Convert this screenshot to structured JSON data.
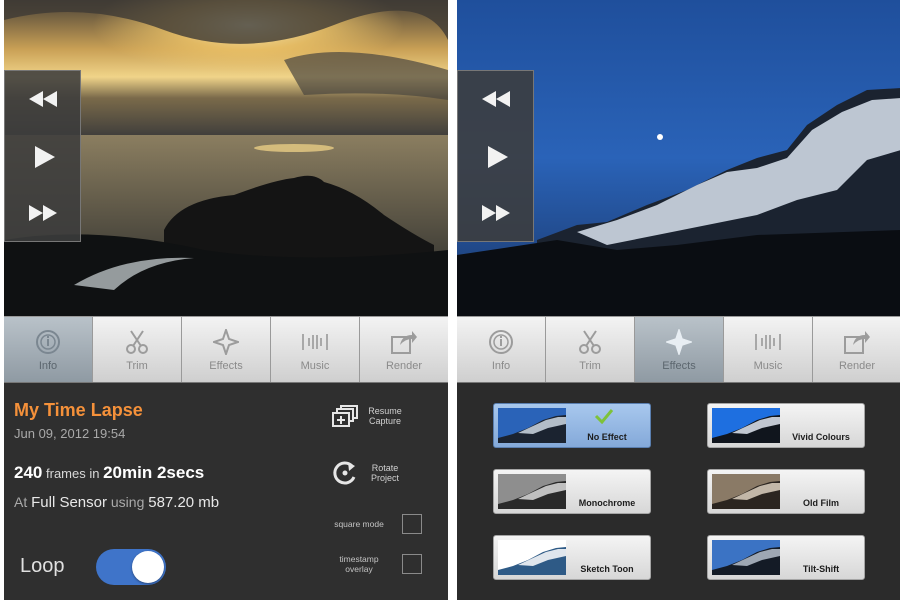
{
  "left_screen": {
    "tabs": [
      {
        "label": "Info",
        "icon": "info-icon",
        "active": true
      },
      {
        "label": "Trim",
        "icon": "scissors-icon",
        "active": false
      },
      {
        "label": "Effects",
        "icon": "sparkle-icon",
        "active": false
      },
      {
        "label": "Music",
        "icon": "music-icon",
        "active": false
      },
      {
        "label": "Render",
        "icon": "export-icon",
        "active": false
      }
    ],
    "info": {
      "title": "My Time Lapse",
      "date": "Jun 09, 2012 19:54",
      "frames_count": "240",
      "frames_text": "frames in",
      "duration": "20min 2secs",
      "at_text": "At",
      "sensor": "Full Sensor",
      "using_text": "using",
      "size": "587.20 mb",
      "resume_capture": "Resume Capture",
      "rotate_project": "Rotate Project",
      "square_mode": "square mode",
      "timestamp_overlay": "timestamp overlay",
      "loop_label": "Loop",
      "loop_on": true
    }
  },
  "right_screen": {
    "tabs": [
      {
        "label": "Info",
        "icon": "info-icon",
        "active": false
      },
      {
        "label": "Trim",
        "icon": "scissors-icon",
        "active": false
      },
      {
        "label": "Effects",
        "icon": "sparkle-icon",
        "active": true
      },
      {
        "label": "Music",
        "icon": "music-icon",
        "active": false
      },
      {
        "label": "Render",
        "icon": "export-icon",
        "active": false
      }
    ],
    "effects": [
      {
        "label": "No Effect",
        "selected": true
      },
      {
        "label": "Vivid Colours",
        "selected": false
      },
      {
        "label": "Monochrome",
        "selected": false
      },
      {
        "label": "Old Film",
        "selected": false
      },
      {
        "label": "Sketch Toon",
        "selected": false
      },
      {
        "label": "Tilt-Shift",
        "selected": false
      }
    ]
  },
  "colors": {
    "accent_orange": "#f5913a",
    "toggle_blue": "#3f74c9",
    "selected_effect": "#9cbde8"
  }
}
